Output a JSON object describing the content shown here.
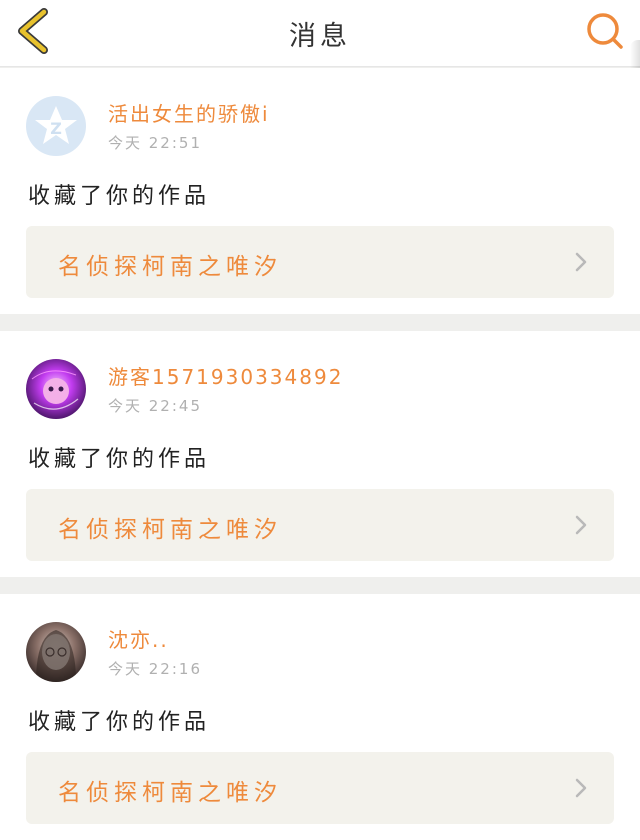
{
  "header": {
    "title": "消息",
    "back_icon": "chevron-left-icon",
    "search_icon": "search-icon"
  },
  "colors": {
    "accent": "#ee8a3c",
    "back_icon": "#e8c22d",
    "background": "#efefed",
    "work_box": "#f3f2ec"
  },
  "messages": [
    {
      "username": "活出女生的骄傲i",
      "time": "今天 22:51",
      "action": "收藏了你的作品",
      "work_title": "名侦探柯南之唯汐",
      "avatar_icon": "qq-default-avatar-icon"
    },
    {
      "username": "游客15719303348​92",
      "time": "今天 22:45",
      "action": "收藏了你的作品",
      "work_title": "名侦探柯南之唯汐",
      "avatar_icon": "avatar-image"
    },
    {
      "username": "沈亦..",
      "time": "今天 22:16",
      "action": "收藏了你的作品",
      "work_title": "名侦探柯南之唯汐",
      "avatar_icon": "avatar-image"
    }
  ]
}
